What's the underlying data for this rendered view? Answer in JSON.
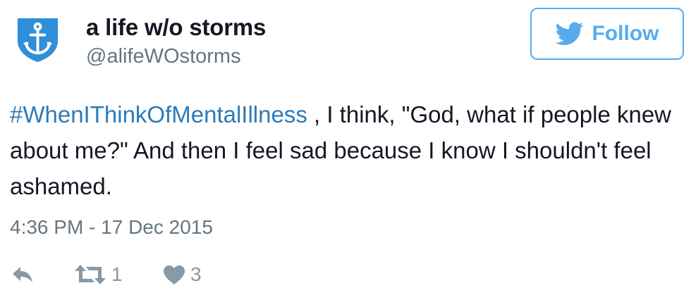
{
  "user": {
    "display_name": "a life w/o storms",
    "handle": "@alifeWOstorms",
    "avatar_icon": "anchor-shield-icon"
  },
  "follow_button": {
    "label": "Follow",
    "icon": "twitter-bird-icon"
  },
  "tweet": {
    "hashtag": "#WhenIThinkOfMentalIllness",
    "text": " , I think, \"God, what if people knew about me?\" And then I feel sad because I know I shouldn't feel ashamed.",
    "timestamp": "4:36 PM - 17 Dec 2015"
  },
  "actions": {
    "reply_icon": "reply-icon",
    "retweet_icon": "retweet-icon",
    "retweet_count": "1",
    "like_icon": "heart-icon",
    "like_count": "3"
  },
  "colors": {
    "brand_blue": "#55acee",
    "hashtag_blue": "#2b7bb9",
    "text_dark": "#141823",
    "text_gray": "#66757f",
    "icon_gray": "#8899a6"
  }
}
